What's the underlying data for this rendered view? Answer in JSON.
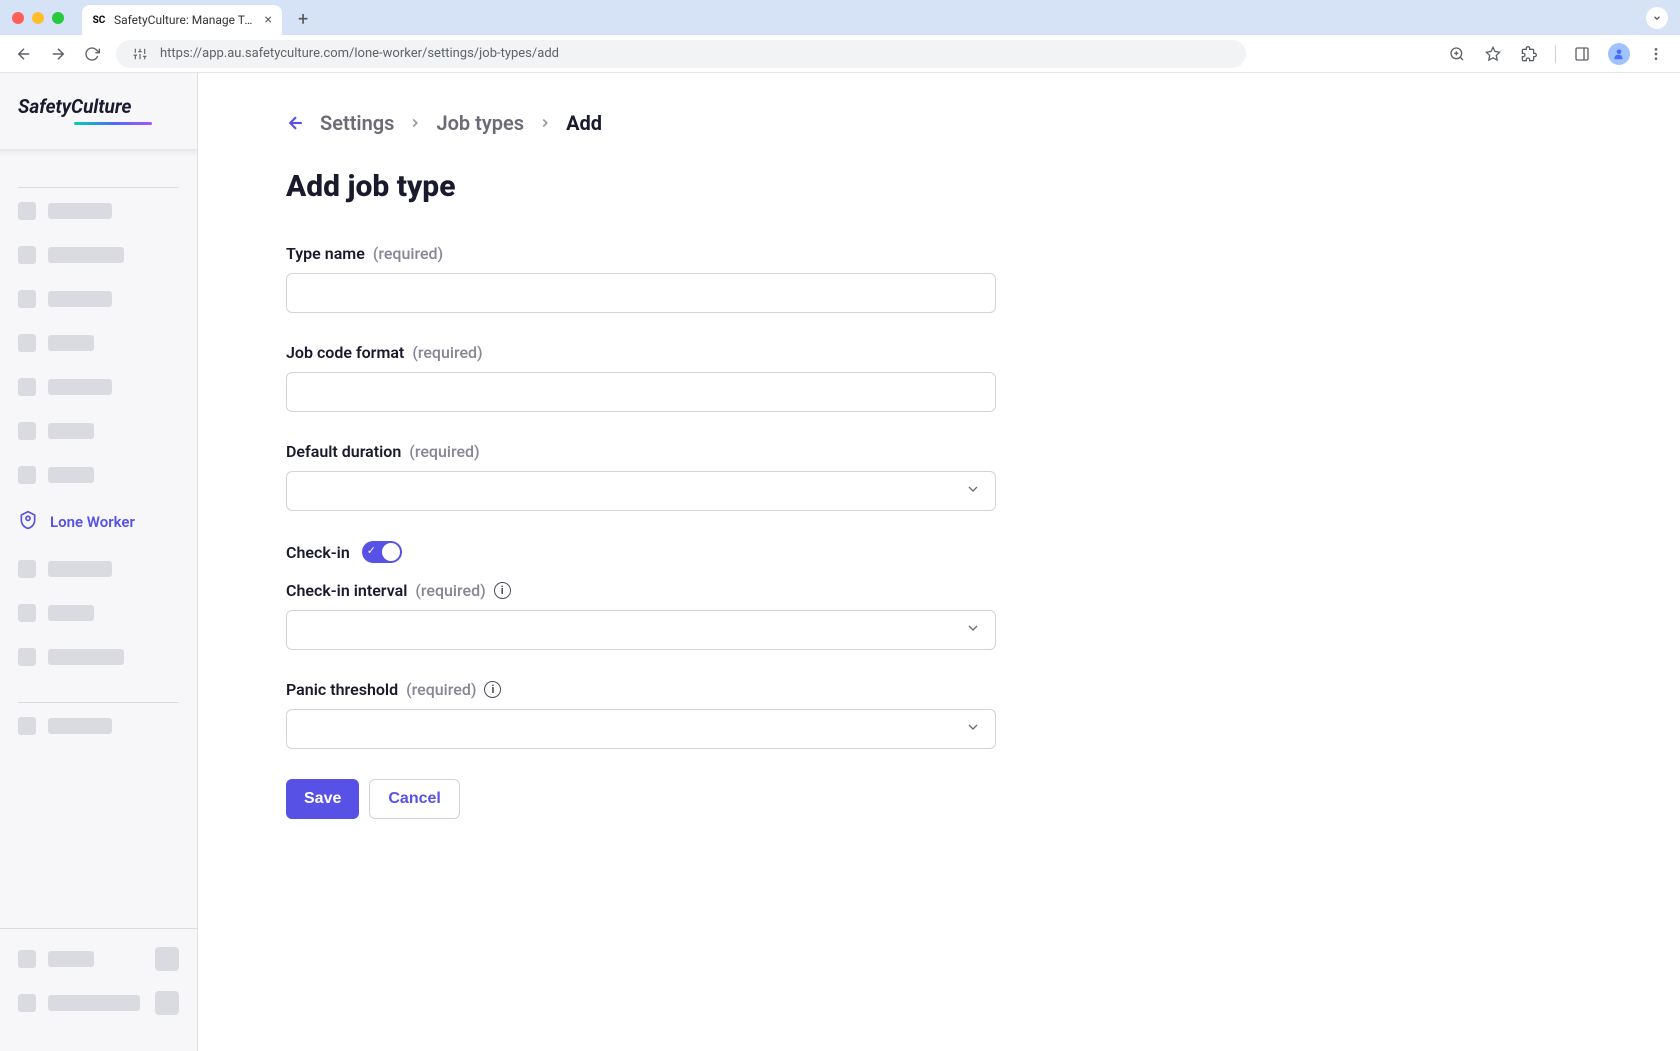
{
  "browser": {
    "tab_title": "SafetyCulture: Manage Teams and...",
    "url": "https://app.au.safetyculture.com/lone-worker/settings/job-types/add"
  },
  "sidebar": {
    "logo": "SafetyCulture",
    "active_item": "Lone Worker"
  },
  "breadcrumb": {
    "items": [
      "Settings",
      "Job types",
      "Add"
    ]
  },
  "page": {
    "title": "Add job type"
  },
  "form": {
    "type_name": {
      "label": "Type name",
      "required": "(required)",
      "value": ""
    },
    "job_code_format": {
      "label": "Job code format",
      "required": "(required)",
      "value": ""
    },
    "default_duration": {
      "label": "Default duration",
      "required": "(required)",
      "value": ""
    },
    "check_in": {
      "label": "Check-in",
      "enabled": true
    },
    "check_in_interval": {
      "label": "Check-in interval",
      "required": "(required)",
      "value": ""
    },
    "panic_threshold": {
      "label": "Panic threshold",
      "required": "(required)",
      "value": ""
    }
  },
  "actions": {
    "save": "Save",
    "cancel": "Cancel"
  }
}
